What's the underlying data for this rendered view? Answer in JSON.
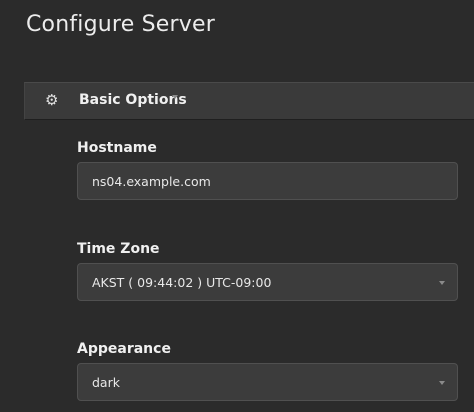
{
  "header": {
    "title": "Configure Server"
  },
  "section": {
    "label": "Basic Options",
    "icon": "gear-icon"
  },
  "fields": {
    "hostname": {
      "label": "Hostname",
      "value": "ns04.example.com"
    },
    "timezone": {
      "label": "Time Zone",
      "value": "AKST ( 09:44:02 ) UTC-09:00"
    },
    "appearance": {
      "label": "Appearance",
      "value": "dark"
    }
  }
}
